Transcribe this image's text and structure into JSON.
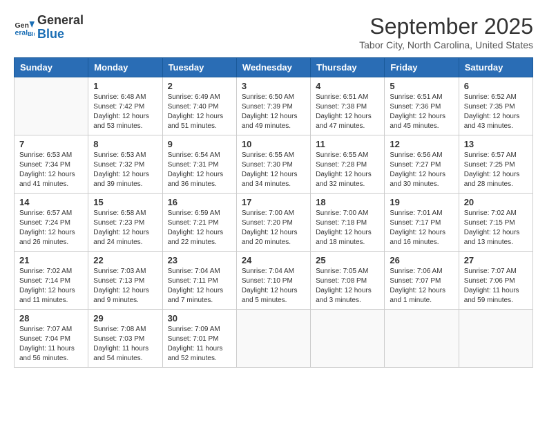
{
  "header": {
    "logo_general": "General",
    "logo_blue": "Blue",
    "month_title": "September 2025",
    "location": "Tabor City, North Carolina, United States"
  },
  "calendar": {
    "columns": [
      "Sunday",
      "Monday",
      "Tuesday",
      "Wednesday",
      "Thursday",
      "Friday",
      "Saturday"
    ],
    "weeks": [
      [
        {
          "day": "",
          "info": ""
        },
        {
          "day": "1",
          "info": "Sunrise: 6:48 AM\nSunset: 7:42 PM\nDaylight: 12 hours\nand 53 minutes."
        },
        {
          "day": "2",
          "info": "Sunrise: 6:49 AM\nSunset: 7:40 PM\nDaylight: 12 hours\nand 51 minutes."
        },
        {
          "day": "3",
          "info": "Sunrise: 6:50 AM\nSunset: 7:39 PM\nDaylight: 12 hours\nand 49 minutes."
        },
        {
          "day": "4",
          "info": "Sunrise: 6:51 AM\nSunset: 7:38 PM\nDaylight: 12 hours\nand 47 minutes."
        },
        {
          "day": "5",
          "info": "Sunrise: 6:51 AM\nSunset: 7:36 PM\nDaylight: 12 hours\nand 45 minutes."
        },
        {
          "day": "6",
          "info": "Sunrise: 6:52 AM\nSunset: 7:35 PM\nDaylight: 12 hours\nand 43 minutes."
        }
      ],
      [
        {
          "day": "7",
          "info": "Sunrise: 6:53 AM\nSunset: 7:34 PM\nDaylight: 12 hours\nand 41 minutes."
        },
        {
          "day": "8",
          "info": "Sunrise: 6:53 AM\nSunset: 7:32 PM\nDaylight: 12 hours\nand 39 minutes."
        },
        {
          "day": "9",
          "info": "Sunrise: 6:54 AM\nSunset: 7:31 PM\nDaylight: 12 hours\nand 36 minutes."
        },
        {
          "day": "10",
          "info": "Sunrise: 6:55 AM\nSunset: 7:30 PM\nDaylight: 12 hours\nand 34 minutes."
        },
        {
          "day": "11",
          "info": "Sunrise: 6:55 AM\nSunset: 7:28 PM\nDaylight: 12 hours\nand 32 minutes."
        },
        {
          "day": "12",
          "info": "Sunrise: 6:56 AM\nSunset: 7:27 PM\nDaylight: 12 hours\nand 30 minutes."
        },
        {
          "day": "13",
          "info": "Sunrise: 6:57 AM\nSunset: 7:25 PM\nDaylight: 12 hours\nand 28 minutes."
        }
      ],
      [
        {
          "day": "14",
          "info": "Sunrise: 6:57 AM\nSunset: 7:24 PM\nDaylight: 12 hours\nand 26 minutes."
        },
        {
          "day": "15",
          "info": "Sunrise: 6:58 AM\nSunset: 7:23 PM\nDaylight: 12 hours\nand 24 minutes."
        },
        {
          "day": "16",
          "info": "Sunrise: 6:59 AM\nSunset: 7:21 PM\nDaylight: 12 hours\nand 22 minutes."
        },
        {
          "day": "17",
          "info": "Sunrise: 7:00 AM\nSunset: 7:20 PM\nDaylight: 12 hours\nand 20 minutes."
        },
        {
          "day": "18",
          "info": "Sunrise: 7:00 AM\nSunset: 7:18 PM\nDaylight: 12 hours\nand 18 minutes."
        },
        {
          "day": "19",
          "info": "Sunrise: 7:01 AM\nSunset: 7:17 PM\nDaylight: 12 hours\nand 16 minutes."
        },
        {
          "day": "20",
          "info": "Sunrise: 7:02 AM\nSunset: 7:15 PM\nDaylight: 12 hours\nand 13 minutes."
        }
      ],
      [
        {
          "day": "21",
          "info": "Sunrise: 7:02 AM\nSunset: 7:14 PM\nDaylight: 12 hours\nand 11 minutes."
        },
        {
          "day": "22",
          "info": "Sunrise: 7:03 AM\nSunset: 7:13 PM\nDaylight: 12 hours\nand 9 minutes."
        },
        {
          "day": "23",
          "info": "Sunrise: 7:04 AM\nSunset: 7:11 PM\nDaylight: 12 hours\nand 7 minutes."
        },
        {
          "day": "24",
          "info": "Sunrise: 7:04 AM\nSunset: 7:10 PM\nDaylight: 12 hours\nand 5 minutes."
        },
        {
          "day": "25",
          "info": "Sunrise: 7:05 AM\nSunset: 7:08 PM\nDaylight: 12 hours\nand 3 minutes."
        },
        {
          "day": "26",
          "info": "Sunrise: 7:06 AM\nSunset: 7:07 PM\nDaylight: 12 hours\nand 1 minute."
        },
        {
          "day": "27",
          "info": "Sunrise: 7:07 AM\nSunset: 7:06 PM\nDaylight: 11 hours\nand 59 minutes."
        }
      ],
      [
        {
          "day": "28",
          "info": "Sunrise: 7:07 AM\nSunset: 7:04 PM\nDaylight: 11 hours\nand 56 minutes."
        },
        {
          "day": "29",
          "info": "Sunrise: 7:08 AM\nSunset: 7:03 PM\nDaylight: 11 hours\nand 54 minutes."
        },
        {
          "day": "30",
          "info": "Sunrise: 7:09 AM\nSunset: 7:01 PM\nDaylight: 11 hours\nand 52 minutes."
        },
        {
          "day": "",
          "info": ""
        },
        {
          "day": "",
          "info": ""
        },
        {
          "day": "",
          "info": ""
        },
        {
          "day": "",
          "info": ""
        }
      ]
    ]
  }
}
